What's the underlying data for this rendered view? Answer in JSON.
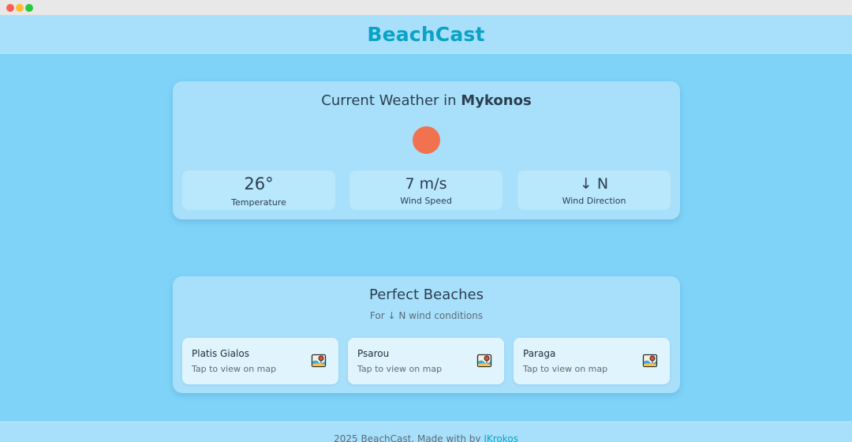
{
  "window": {
    "controls": [
      "close",
      "minimize",
      "zoom"
    ]
  },
  "header": {
    "title": "BeachCast"
  },
  "weather": {
    "title_prefix": "Current Weather in",
    "location": "Mykonos",
    "icon": "sun-icon",
    "stats": [
      {
        "value": "26°",
        "label": "Temperature"
      },
      {
        "value": "7 m/s",
        "label": "Wind Speed"
      },
      {
        "value": "↓ N",
        "label": "Wind Direction"
      }
    ]
  },
  "beaches": {
    "title": "Perfect Beaches",
    "subtitle": "For ↓ N wind conditions",
    "items": [
      {
        "name": "Platis Gialos",
        "hint": "Tap to view on map",
        "icon": "map-icon"
      },
      {
        "name": "Psarou",
        "hint": "Tap to view on map",
        "icon": "map-icon"
      },
      {
        "name": "Paraga",
        "hint": "Tap to view on map",
        "icon": "map-icon"
      }
    ]
  },
  "footer": {
    "text": "2025 BeachCast. Made with by",
    "link": "JKrokos"
  },
  "colors": {
    "background": "#7fd3f8",
    "card": "#a8e0fb",
    "accent": "#0aa2c6",
    "sun": "#f1724f"
  }
}
